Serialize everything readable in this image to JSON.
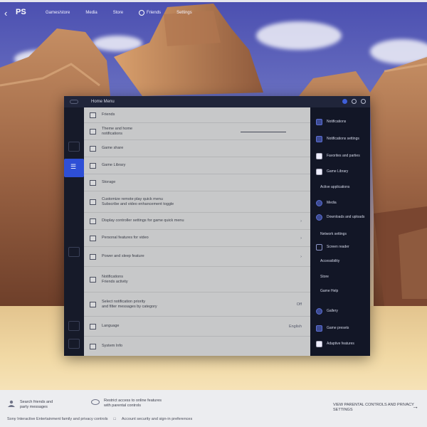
{
  "topbar": {
    "back_icon": "chevron-left-icon",
    "logo": "playstation-logo",
    "items": [
      {
        "label": "Games/store"
      },
      {
        "label": "Media"
      },
      {
        "label": "Store"
      },
      {
        "label": "Friends"
      },
      {
        "label": "Settings"
      }
    ]
  },
  "dialog": {
    "title": "Home Menu",
    "rows": [
      {
        "label": "Friends"
      },
      {
        "label": "Theme and home\nnotifications",
        "slider": true
      },
      {
        "label": "Game share"
      },
      {
        "label": "Game Library"
      },
      {
        "label": "Storage"
      },
      {
        "label": "Customize remote play quick menu\nSubscribe and video enhancement toggle"
      },
      {
        "label": "Display controller settings for game quick menu",
        "meta": "›"
      },
      {
        "label": "Personal features for video",
        "meta": "›"
      },
      {
        "label": "Power and sleep feature",
        "meta": "›"
      },
      {
        "label": "Notifications\nFriends activity"
      },
      {
        "label": "Select notification priority\nand filter messages by category",
        "meta": "Off"
      },
      {
        "label": "Language",
        "meta": "English"
      },
      {
        "label": "System Info"
      }
    ]
  },
  "sidebar": {
    "items": [
      {
        "label": "Notifications"
      },
      {
        "label": "Notifications settings"
      },
      {
        "label": "Favorites and parties"
      },
      {
        "label": "Game Library"
      },
      {
        "label": "Active applications"
      },
      {
        "label": "Media"
      },
      {
        "label": "Downloads and uploads"
      },
      {
        "label": "Network settings"
      },
      {
        "label": "Screen reader"
      },
      {
        "label": "Accessibility"
      },
      {
        "label": "Store"
      },
      {
        "label": "Game Help"
      },
      {
        "label": "Gallery"
      },
      {
        "label": "Game presets"
      },
      {
        "label": "Adaptive features"
      }
    ]
  },
  "bottombar": {
    "left_text": "Search friends and\nparty messages",
    "middle_text": "Restrict access to online features\nwith parental controls",
    "right_text": "VIEW PARENTAL CONTROLS AND PRIVACY SETTINGS",
    "footer_left": "Sony Interactive Entertainment family and privacy controls",
    "footer_right": "Account security and sign-in preferences"
  },
  "colors": {
    "accent": "#2e4fd6",
    "panel": "#c7c8c9",
    "dialog_bg": "#1a1e2f",
    "sidebar_bg": "#121626"
  }
}
